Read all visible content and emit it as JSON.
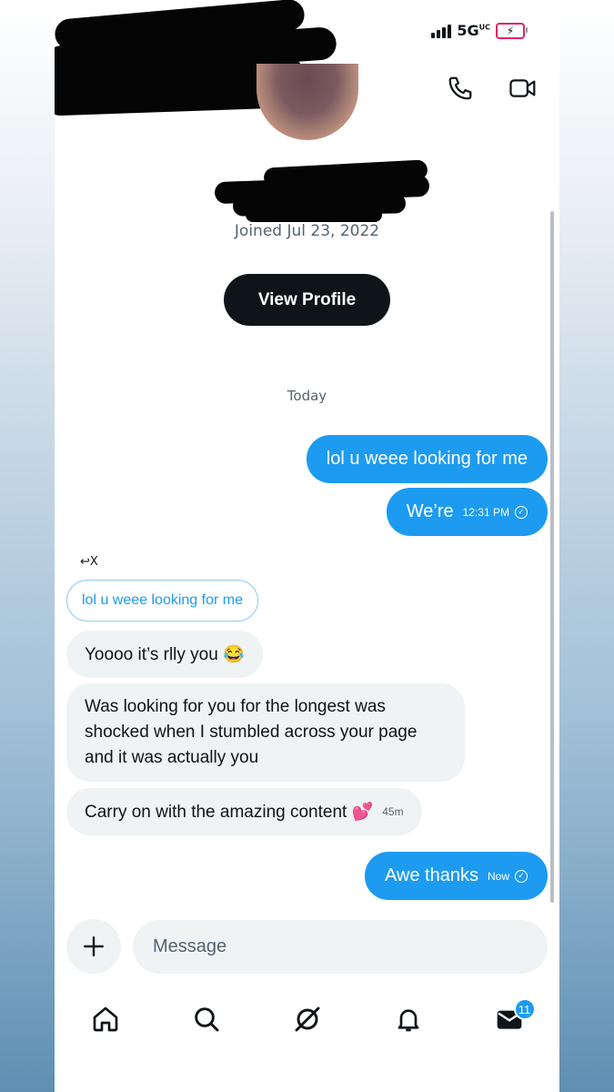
{
  "status_bar": {
    "network": "5G",
    "network_suffix": "UC"
  },
  "profile": {
    "joined": "Joined Jul 23, 2022",
    "view_profile_label": "View Profile"
  },
  "conversation": {
    "day_label": "Today",
    "sent_1": {
      "text": "lol u weee looking for me"
    },
    "sent_2": {
      "text": "We’re",
      "time": "12:31 PM"
    },
    "reply_indicator": "X",
    "quoted": "lol u weee looking for me",
    "received_1": {
      "text": "Yoooo it’s rlly you 😂"
    },
    "received_2": {
      "text": "Was looking for you for the longest was shocked when I stumbled across your page and it was actually you"
    },
    "received_3": {
      "text": "Carry on with the amazing  content 💕",
      "time": "45m"
    },
    "sent_3": {
      "text": "Awe thanks",
      "time": "Now"
    }
  },
  "composer": {
    "placeholder": "Message"
  },
  "bottom_nav": {
    "messages_badge": "11"
  },
  "colors": {
    "accent": "#1d9bf0",
    "dark": "#0f1419",
    "bubble_in": "#eff3f4",
    "muted": "#536471"
  },
  "icons": [
    "phone-icon",
    "video-icon",
    "plus-icon",
    "home-icon",
    "search-icon",
    "grok-icon",
    "notifications-icon",
    "messages-icon",
    "reply-icon",
    "check-icon"
  ]
}
